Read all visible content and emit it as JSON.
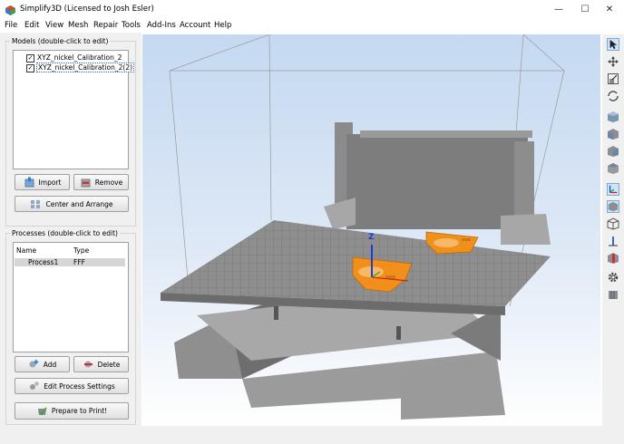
{
  "window": {
    "title": "Simplify3D (Licensed to Josh Esler)",
    "minimize_glyph": "—",
    "maximize_glyph": "☐",
    "close_glyph": "✕"
  },
  "menu": [
    "File",
    "Edit",
    "View",
    "Mesh",
    "Repair",
    "Tools",
    "Add-Ins",
    "Account",
    "Help"
  ],
  "models": {
    "group_label": "Models (double-click to edit)",
    "items": [
      {
        "label": "XYZ_nickel_Calibration_2",
        "checked": true,
        "selected": false
      },
      {
        "label": "XYZ_nickel_Calibration_2(2)",
        "checked": true,
        "selected": true
      }
    ],
    "import_label": "Import",
    "remove_label": "Remove",
    "center_label": "Center and Arrange"
  },
  "processes": {
    "group_label": "Processes (double-click to edit)",
    "columns": [
      "Name",
      "Type"
    ],
    "rows": [
      {
        "name": "Process1",
        "type": "FFF"
      }
    ],
    "add_label": "Add",
    "delete_label": "Delete",
    "edit_label": "Edit Process Settings",
    "prepare_label": "Prepare to Print!"
  },
  "viewport": {
    "axis_z_label": "Z",
    "bed_color": "#8a8a8a",
    "part_color": "#f0901a",
    "background_top": "#c9dcf2",
    "background_bottom": "#ffffff"
  },
  "toolbar_icons": [
    "select-cursor-icon",
    "move-icon",
    "scale-icon",
    "rotate-icon",
    "iso-view-icon",
    "front-view-icon",
    "left-view-icon",
    "right-view-icon",
    "axes-toggle-icon",
    "solid-view-icon",
    "wireframe-view-icon",
    "z-axis-icon",
    "cross-section-icon",
    "settings-gear-icon",
    "layers-icon"
  ]
}
